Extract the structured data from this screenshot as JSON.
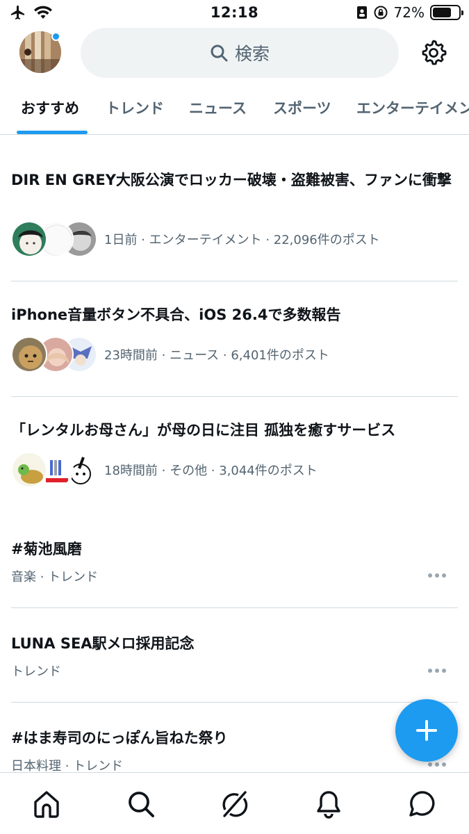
{
  "status_bar": {
    "time": "12:18",
    "battery": "72%",
    "battery_level": 0.72,
    "icons": [
      "airplane-icon",
      "wifi-icon",
      "contact-card-icon",
      "orientation-lock-icon",
      "battery-icon"
    ]
  },
  "header": {
    "search_label": "検索",
    "icons": [
      "avatar",
      "search-icon",
      "gear-icon"
    ]
  },
  "tabs": [
    {
      "label": "おすすめ",
      "active": true
    },
    {
      "label": "トレンド",
      "active": false
    },
    {
      "label": "ニュース",
      "active": false
    },
    {
      "label": "スポーツ",
      "active": false
    },
    {
      "label": "エンターテイメント",
      "active": false
    }
  ],
  "news": [
    {
      "title": "DIR EN GREY大阪公演でロッカー破壊・盗難被害、ファンに衝撃",
      "meta": "1日前 · エンターテイメント · 22,096件のポスト"
    },
    {
      "title": "iPhone音量ボタン不具合、iOS 26.4で多数報告",
      "meta": "23時間前 · ニュース · 6,401件のポスト"
    },
    {
      "title": "「レンタルお母さん」が母の日に注目 孤独を癒すサービス",
      "meta": "18時間前 · その他 · 3,044件のポスト"
    }
  ],
  "trends": [
    {
      "title": "#菊池風磨",
      "sub": "音楽 · トレンド"
    },
    {
      "title": "LUNA SEA駅メロ採用記念",
      "sub": "トレンド"
    },
    {
      "title": "#はま寿司のにっぽん旨ねた祭り",
      "sub": "日本料理 · トレンド"
    }
  ],
  "colors": {
    "accent": "#1d9bf0",
    "text": "#0f1419",
    "secondary": "#536471",
    "divider": "#cfd9de"
  },
  "bottom_nav": [
    "home-icon",
    "search-icon",
    "grok-icon",
    "bell-icon",
    "messages-icon"
  ]
}
